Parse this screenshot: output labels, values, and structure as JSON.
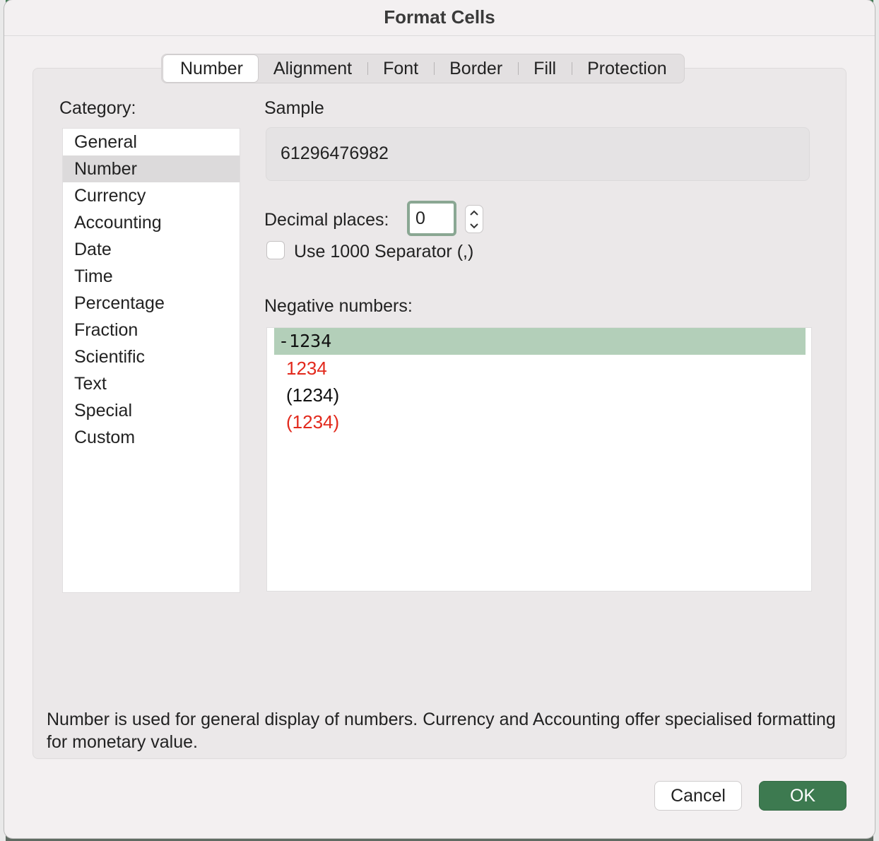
{
  "dialog": {
    "title": "Format Cells"
  },
  "tabs": [
    {
      "label": "Number",
      "active": true
    },
    {
      "label": "Alignment",
      "active": false
    },
    {
      "label": "Font",
      "active": false
    },
    {
      "label": "Border",
      "active": false
    },
    {
      "label": "Fill",
      "active": false
    },
    {
      "label": "Protection",
      "active": false
    }
  ],
  "category": {
    "label": "Category:",
    "selected": "Number",
    "items": [
      "General",
      "Number",
      "Currency",
      "Accounting",
      "Date",
      "Time",
      "Percentage",
      "Fraction",
      "Scientific",
      "Text",
      "Special",
      "Custom"
    ]
  },
  "sample": {
    "label": "Sample",
    "value": "61296476982"
  },
  "decimal_places": {
    "label": "Decimal places:",
    "value": "0"
  },
  "separator": {
    "label": "Use 1000 Separator (,)",
    "checked": false
  },
  "negative_numbers": {
    "label": "Negative numbers:",
    "items": [
      {
        "text": "-1234",
        "color": "#111111",
        "selected": true
      },
      {
        "text": "1234",
        "color": "#e2291c",
        "selected": false
      },
      {
        "text": "(1234)",
        "color": "#111111",
        "selected": false
      },
      {
        "text": "(1234)",
        "color": "#e2291c",
        "selected": false
      }
    ]
  },
  "description": "Number is used for general display of numbers.  Currency and Accounting offer specialised formatting for monetary value.",
  "buttons": {
    "cancel": "Cancel",
    "ok": "OK"
  },
  "colors": {
    "accent": "#3d7a50",
    "selection_green": "#b3cfb9",
    "negative_red": "#e2291c"
  }
}
